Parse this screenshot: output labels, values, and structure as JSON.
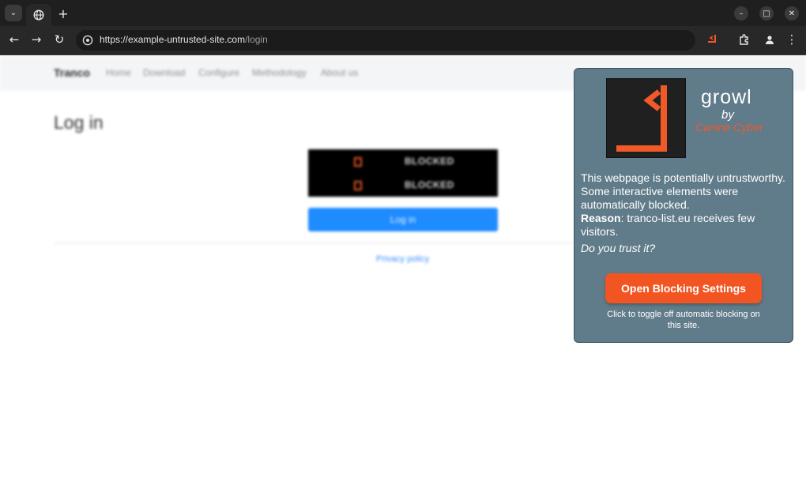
{
  "browser": {
    "url_host": "https://example-untrusted-site.com",
    "url_path": "/login",
    "new_tab_glyph": "+",
    "tab_menu_glyph": "⌄",
    "back_glyph": "←",
    "forward_glyph": "→",
    "reload_glyph": "↻",
    "menu_glyph": "⋮",
    "minimize_glyph": "–",
    "maximize_glyph": "□",
    "close_glyph": "✕",
    "icons": [
      "tab-menu-icon",
      "globe-icon",
      "new-tab-icon",
      "back-icon",
      "forward-icon",
      "reload-icon",
      "site-info-icon",
      "growl-extension-icon",
      "extensions-puzzle-icon",
      "profile-icon",
      "kebab-menu-icon",
      "minimize-icon",
      "maximize-icon",
      "close-icon"
    ]
  },
  "site": {
    "brand": "Tranco",
    "nav": [
      "Home",
      "Download",
      "Configure",
      "Methodology",
      "About us"
    ],
    "title": "Log in",
    "blocked_fields": [
      "BLOCKED",
      "BLOCKED"
    ],
    "login_button": "Log in",
    "privacy_link": "Privacy policy"
  },
  "popup": {
    "title": "growl",
    "by": "by",
    "company": "Canine Cyber",
    "message": "This webpage is potentially untrustworthy. Some interactive elements were automatically blocked.",
    "reason_label": "Reason",
    "reason_text": ": tranco-list.eu receives few visitors.",
    "question": "Do you trust it?",
    "button": "Open Blocking Settings",
    "note": "Click to toggle off automatic blocking on this site.",
    "accent_color": "#f05a28",
    "panel_color": "#607b89"
  }
}
